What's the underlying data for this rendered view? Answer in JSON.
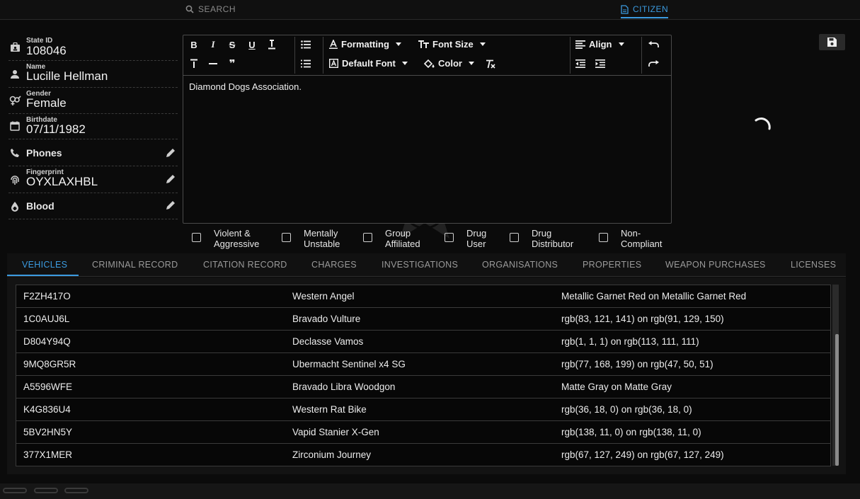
{
  "topbar": {
    "search_label": "SEARCH",
    "citizen_label": "CITIZEN"
  },
  "profile": {
    "state_id_label": "State ID",
    "state_id": "108046",
    "name_label": "Name",
    "name": "Lucille Hellman",
    "gender_label": "Gender",
    "gender": "Female",
    "birthdate_label": "Birthdate",
    "birthdate": "07/11/1982",
    "phones_label": "Phones",
    "fingerprint_label": "Fingerprint",
    "fingerprint": "OYXLAXHBL",
    "blood_label": "Blood"
  },
  "editor": {
    "formatting_label": "Formatting",
    "font_size_label": "Font Size",
    "default_font_label": "Default Font",
    "color_label": "Color",
    "align_label": "Align",
    "content": "Diamond Dogs Association."
  },
  "flags": [
    {
      "line1": "Violent &",
      "line2": "Aggressive"
    },
    {
      "line1": "Mentally",
      "line2": "Unstable"
    },
    {
      "line1": "Group",
      "line2": "Affiliated"
    },
    {
      "line1": "Drug",
      "line2": "User"
    },
    {
      "line1": "Drug",
      "line2": "Distributor"
    },
    {
      "line1": "Non-",
      "line2": "Compliant"
    }
  ],
  "tabs": [
    "VEHICLES",
    "CRIMINAL RECORD",
    "CITATION RECORD",
    "CHARGES",
    "INVESTIGATIONS",
    "ORGANISATIONS",
    "PROPERTIES",
    "WEAPON PURCHASES",
    "LICENSES"
  ],
  "vehicles": [
    {
      "plate": "F2ZH417O",
      "model": "Western Angel",
      "color": "Metallic Garnet Red on Metallic Garnet Red"
    },
    {
      "plate": "1C0AUJ6L",
      "model": "Bravado Vulture",
      "color": "rgb(83, 121, 141) on rgb(91, 129, 150)"
    },
    {
      "plate": "D804Y94Q",
      "model": "Declasse Vamos",
      "color": "rgb(1, 1, 1) on rgb(113, 111, 111)"
    },
    {
      "plate": "9MQ8GR5R",
      "model": "Ubermacht Sentinel x4 SG",
      "color": "rgb(77, 168, 199) on rgb(47, 50, 51)"
    },
    {
      "plate": "A5596WFE",
      "model": "Bravado Libra Woodgon",
      "color": "Matte Gray on Matte Gray"
    },
    {
      "plate": "K4G836U4",
      "model": "Western Rat Bike",
      "color": "rgb(36, 18, 0) on rgb(36, 18, 0)"
    },
    {
      "plate": "5BV2HN5Y",
      "model": "Vapid Stanier X-Gen",
      "color": "rgb(138, 11, 0) on rgb(138, 11, 0)"
    },
    {
      "plate": "377X1MER",
      "model": "Zirconium Journey",
      "color": "rgb(67, 127, 249) on rgb(67, 127, 249)"
    }
  ],
  "colors": {
    "accent": "#3b9be0",
    "background": "#0b0b0b"
  }
}
